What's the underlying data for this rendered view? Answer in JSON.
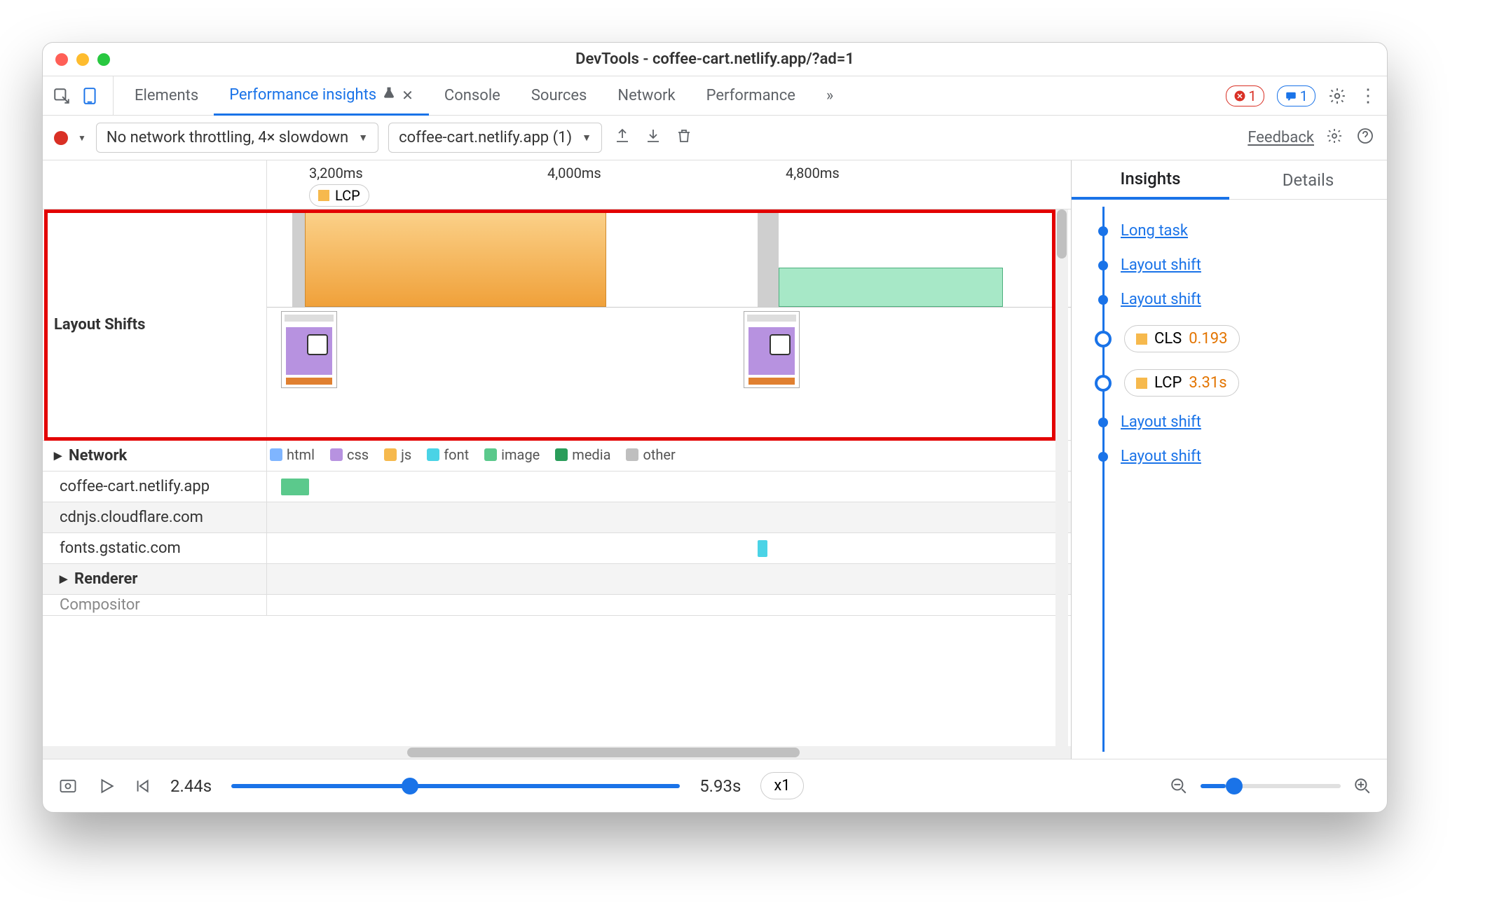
{
  "window_title": "DevTools - coffee-cart.netlify.app/?ad=1",
  "tabs": {
    "elements": "Elements",
    "perf_insights": "Performance insights",
    "console": "Console",
    "sources": "Sources",
    "network": "Network",
    "performance": "Performance"
  },
  "badges": {
    "errors": "1",
    "messages": "1"
  },
  "toolbar": {
    "throttling": "No network throttling, 4× slowdown",
    "recording": "coffee-cart.netlify.app (1)",
    "feedback": "Feedback"
  },
  "timeline": {
    "ticks": [
      "3,200ms",
      "4,000ms",
      "4,800ms"
    ],
    "lcp_marker": "LCP",
    "layout_shifts_label": "Layout Shifts",
    "network_label": "Network",
    "renderer_label": "Renderer",
    "compositor_label": "Compositor",
    "legend": {
      "html": "html",
      "css": "css",
      "js": "js",
      "font": "font",
      "image": "image",
      "media": "media",
      "other": "other"
    },
    "network_rows": [
      "coffee-cart.netlify.app",
      "cdnjs.cloudflare.com",
      "fonts.gstatic.com"
    ]
  },
  "side": {
    "insights_tab": "Insights",
    "details_tab": "Details",
    "items": {
      "long_task": "Long task",
      "layout_shift": "Layout shift",
      "cls_label": "CLS",
      "cls_value": "0.193",
      "lcp_label": "LCP",
      "lcp_value": "3.31s"
    }
  },
  "footer": {
    "start": "2.44s",
    "end": "5.93s",
    "speed": "x1"
  }
}
